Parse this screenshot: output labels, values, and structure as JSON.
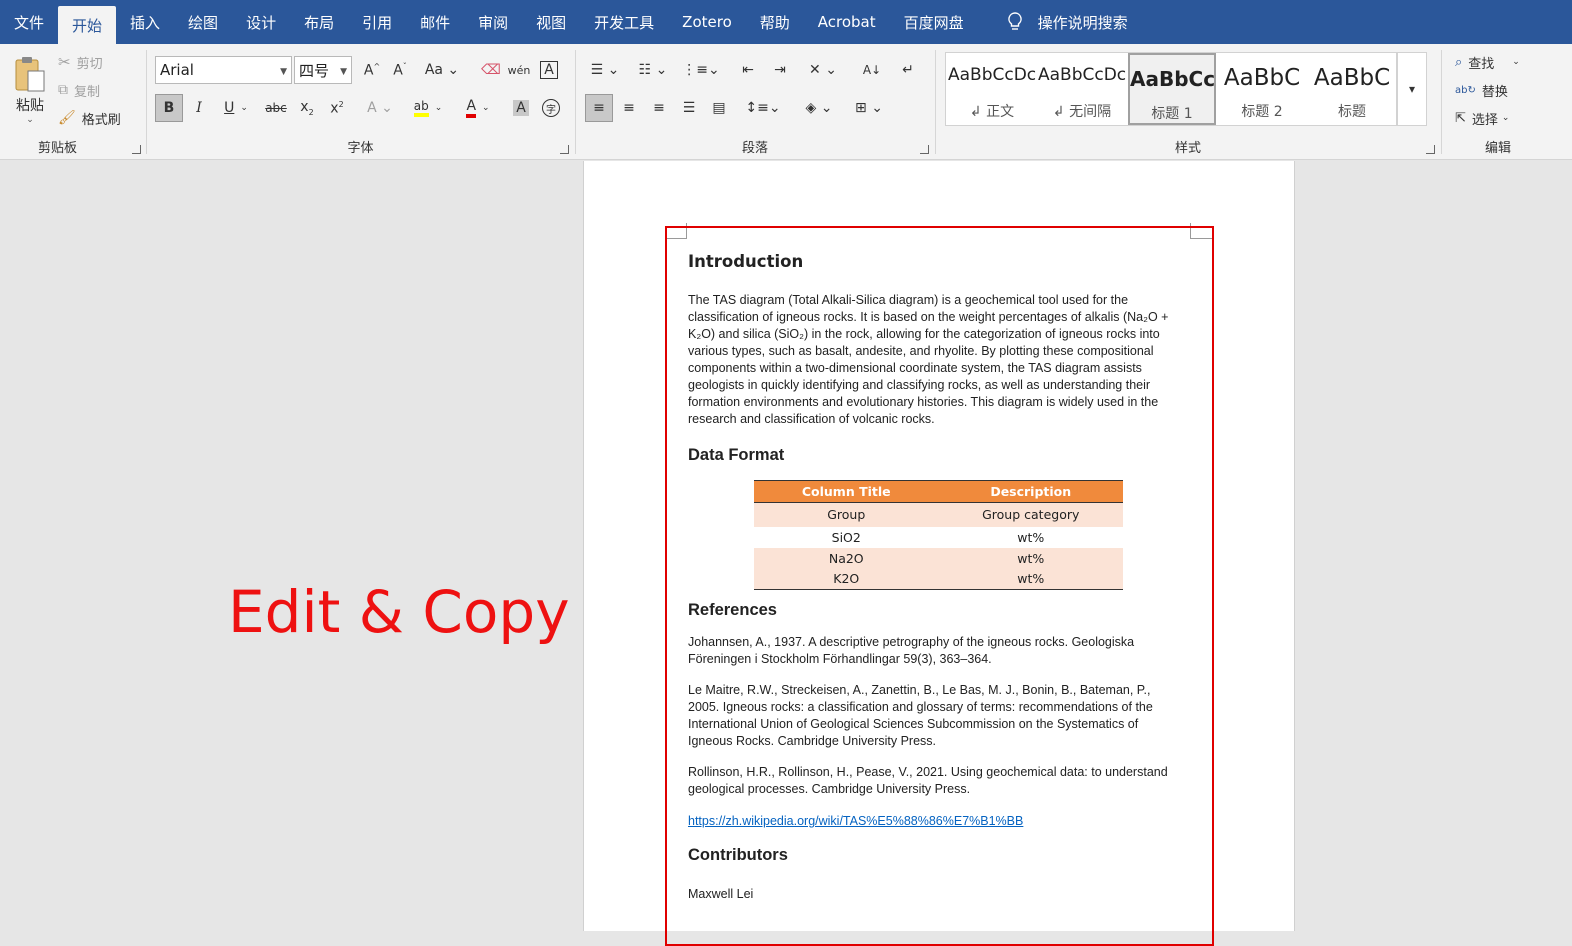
{
  "tabs": [
    "文件",
    "开始",
    "插入",
    "绘图",
    "设计",
    "布局",
    "引用",
    "邮件",
    "审阅",
    "视图",
    "开发工具",
    "Zotero",
    "帮助",
    "Acrobat",
    "百度网盘"
  ],
  "search_label": "操作说明搜索",
  "clipboard": {
    "paste": "粘贴",
    "cut": "剪切",
    "copy": "复制",
    "format_painter": "格式刷",
    "group": "剪贴板"
  },
  "font": {
    "name": "Arial",
    "size": "四号",
    "group": "字体"
  },
  "paragraph": {
    "group": "段落"
  },
  "styles": {
    "group": "样式",
    "items": [
      {
        "preview": "AaBbCcDc",
        "name": "↲ 正文"
      },
      {
        "preview": "AaBbCcDc",
        "name": "↲ 无间隔"
      },
      {
        "preview": "AaBbCc",
        "name": "标题 1"
      },
      {
        "preview": "AaBbC",
        "name": "标题 2"
      },
      {
        "preview": "AaBbC",
        "name": "标题"
      }
    ]
  },
  "editing": {
    "find": "查找",
    "replace": "替换",
    "select": "选择",
    "group": "编辑"
  },
  "overlay_text": "Edit & Copy",
  "document": {
    "intro_heading": "Introduction",
    "intro_text": "The TAS diagram (Total Alkali-Silica diagram) is a geochemical tool used for the classification of igneous rocks. It is based on the weight percentages of alkalis (Na₂O + K₂O) and silica (SiO₂) in the rock, allowing for the categorization of igneous rocks into various types, such as basalt, andesite, and rhyolite. By plotting these compositional components within a two-dimensional coordinate system, the TAS diagram assists geologists in quickly identifying and classifying rocks, as well as understanding their formation environments and evolutionary histories. This diagram is widely used in the research and classification of volcanic rocks.",
    "data_heading": "Data Format",
    "table_headers": [
      "Column Title",
      "Description"
    ],
    "table_rows": [
      [
        "Group",
        "Group category"
      ],
      [
        "SiO2",
        "wt%"
      ],
      [
        "Na2O",
        "wt%"
      ],
      [
        "K2O",
        "wt%"
      ]
    ],
    "ref_heading": "References",
    "ref1": "Johannsen, A., 1937. A descriptive petrography of the igneous rocks. Geologiska Föreningen i Stockholm Förhandlingar 59(3), 363–364.",
    "ref2": "Le Maitre, R.W., Streckeisen, A., Zanettin, B., Le Bas, M. J., Bonin, B., Bateman, P., 2005. Igneous rocks: a classification and glossary of terms: recommendations of the International Union of Geological Sciences Subcommission on the Systematics of Igneous Rocks. Cambridge University Press.",
    "ref3": "Rollinson, H.R., Rollinson, H., Pease, V., 2021. Using geochemical data: to understand geological processes. Cambridge University Press.",
    "link": "https://zh.wikipedia.org/wiki/TAS%E5%88%86%E7%B1%BB",
    "contrib_heading": "Contributors",
    "contributor": "Maxwell Lei"
  }
}
